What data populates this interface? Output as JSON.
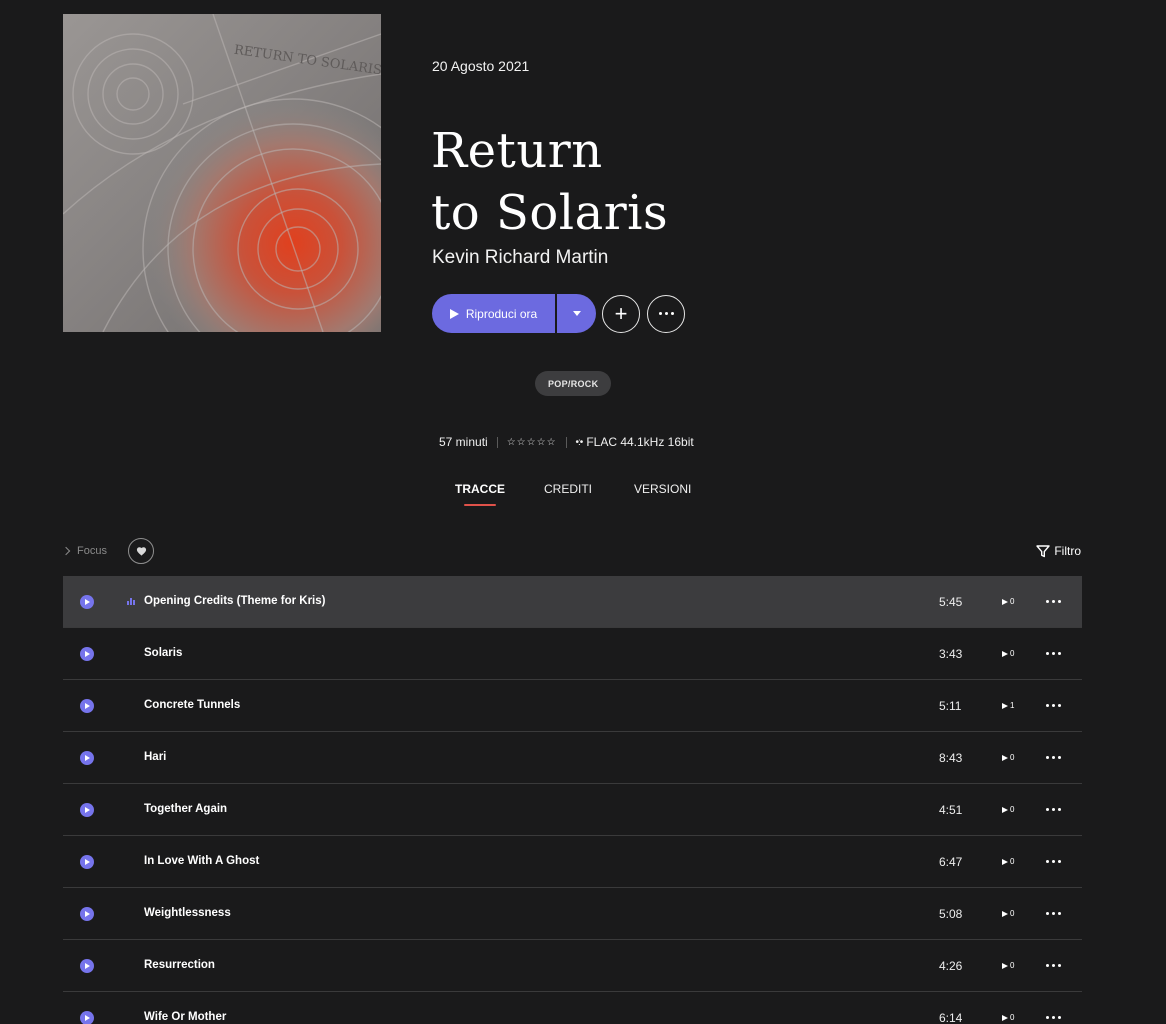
{
  "album": {
    "release_date": "20 Agosto 2021",
    "title_line1": "Return",
    "title_line2": "to Solaris",
    "artist": "Kevin Richard Martin",
    "cover_text": "RETURN TO SOLARIS"
  },
  "actions": {
    "play_label": "Riproduci ora",
    "add_icon": "plus-icon",
    "more_icon": "more-icon"
  },
  "genre": "POP/ROCK",
  "meta": {
    "duration": "57 minuti",
    "stars": "☆☆☆☆☆",
    "format": "FLAC 44.1kHz 16bit"
  },
  "tabs": [
    "TRACCE",
    "CREDITI",
    "VERSIONI"
  ],
  "active_tab": "TRACCE",
  "list_controls": {
    "focus_label": "Focus",
    "filter_label": "Filtro"
  },
  "colors": {
    "accent": "#6c6ae0",
    "tab_underline": "#e0524a",
    "background": "#1a1a1b",
    "active_row": "#3c3c3e"
  },
  "tracks": [
    {
      "title": "Opening Credits (Theme for Kris)",
      "duration": "5:45",
      "plays": "0",
      "active": true
    },
    {
      "title": "Solaris",
      "duration": "3:43",
      "plays": "0"
    },
    {
      "title": "Concrete Tunnels",
      "duration": "5:11",
      "plays": "1"
    },
    {
      "title": "Hari",
      "duration": "8:43",
      "plays": "0"
    },
    {
      "title": "Together Again",
      "duration": "4:51",
      "plays": "0"
    },
    {
      "title": "In Love With A Ghost",
      "duration": "6:47",
      "plays": "0"
    },
    {
      "title": "Weightlessness",
      "duration": "5:08",
      "plays": "0"
    },
    {
      "title": "Resurrection",
      "duration": "4:26",
      "plays": "0"
    },
    {
      "title": "Wife Or Mother",
      "duration": "6:14",
      "plays": "0"
    }
  ]
}
